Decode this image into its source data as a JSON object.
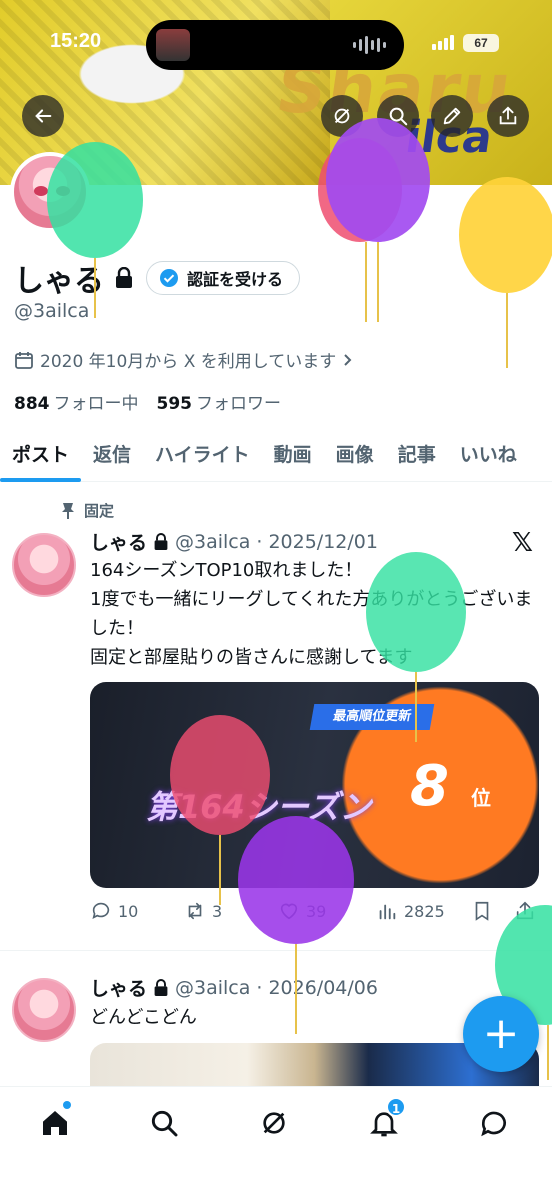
{
  "status_bar": {
    "time": "15:20",
    "battery": "67"
  },
  "profile": {
    "name": "しゃる",
    "handle": "@3ailca",
    "verify_label": "認証を受ける",
    "joined": "2020 年10月から X を利用しています",
    "following_count": "884",
    "following_label": "フォロー中",
    "followers_count": "595",
    "followers_label": "フォロワー"
  },
  "tabs": [
    {
      "label": "ポスト",
      "active": true
    },
    {
      "label": "返信"
    },
    {
      "label": "ハイライト"
    },
    {
      "label": "動画"
    },
    {
      "label": "画像"
    },
    {
      "label": "記事"
    },
    {
      "label": "いいね"
    }
  ],
  "posts": [
    {
      "pinned_label": "固定",
      "name": "しゃる",
      "handle": "@3ailca",
      "date": "2025/12/01",
      "text": "164シーズンTOP10取れました！\n1度でも一緒にリーグしてくれた方ありがとうございました！\n固定と部屋貼りの皆さんに感謝してます",
      "media": {
        "banner": "最高順位更新",
        "season": "第164シーズン",
        "rank": "8",
        "rank_suffix": "位"
      },
      "replies": "10",
      "reposts": "3",
      "likes": "39",
      "views": "2825"
    },
    {
      "name": "しゃる",
      "handle": "@3ailca",
      "date": "2026/04/06",
      "text": "どんどこどん"
    }
  ],
  "fab_label": "+",
  "notifications_badge": "1",
  "colors": {
    "accent": "#1d9bf0",
    "text": "#0f1419",
    "muted": "#536471"
  },
  "balloon_colors": [
    "#34e0a1",
    "#a24bf0",
    "#ffd23a",
    "#ee4d70",
    "#9a36e8",
    "#34e0a1"
  ]
}
